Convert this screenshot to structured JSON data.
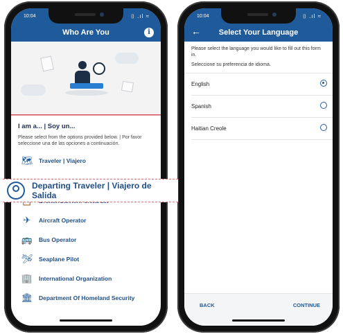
{
  "left": {
    "status": {
      "time": "10:04",
      "signal": "⌷ .ıl ≈"
    },
    "appbar": {
      "title": "Who Are You",
      "info_icon": "i"
    },
    "section_title": "I am a... | Soy un...",
    "helper": "Please select from the options provided below. | Por favor seleccione una de las opciones a continuación.",
    "roles": [
      {
        "label": "Traveler | Viajero",
        "icon": "map-icon",
        "glyph": "🗺"
      },
      {
        "label": "Broker/Carrier/Forwarder",
        "icon": "clipboard-user-icon",
        "glyph": "📋"
      },
      {
        "label": "Aircraft Operator",
        "icon": "airplane-icon",
        "glyph": "✈"
      },
      {
        "label": "Bus Operator",
        "icon": "bus-icon",
        "glyph": "🚌"
      },
      {
        "label": "Seaplane Pilot",
        "icon": "seaplane-icon",
        "glyph": "🛩"
      },
      {
        "label": "International Organization",
        "icon": "building-icon",
        "glyph": "🏢"
      },
      {
        "label": "Department Of Homeland Security",
        "icon": "dhs-icon",
        "glyph": "🏛"
      }
    ],
    "featured": {
      "label": "Departing Traveler | Viajero de Salida",
      "icon": "user-circle-icon"
    }
  },
  "right": {
    "status": {
      "time": "10:04",
      "signal": "⌷ .ıl ≈"
    },
    "appbar": {
      "title": "Select Your Language",
      "back_icon": "←"
    },
    "intro": "Please select the language you would like to fill out this form in.",
    "intro_es": "Seleccione su preferencia de idioma.",
    "languages": [
      {
        "label": "English",
        "selected": true
      },
      {
        "label": "Spanish",
        "selected": false
      },
      {
        "label": "Haitian Creole",
        "selected": false
      }
    ],
    "back_label": "BACK",
    "continue_label": "CONTINUE"
  },
  "colors": {
    "primary": "#1f5a9a",
    "accent_red": "#d84f5e"
  }
}
